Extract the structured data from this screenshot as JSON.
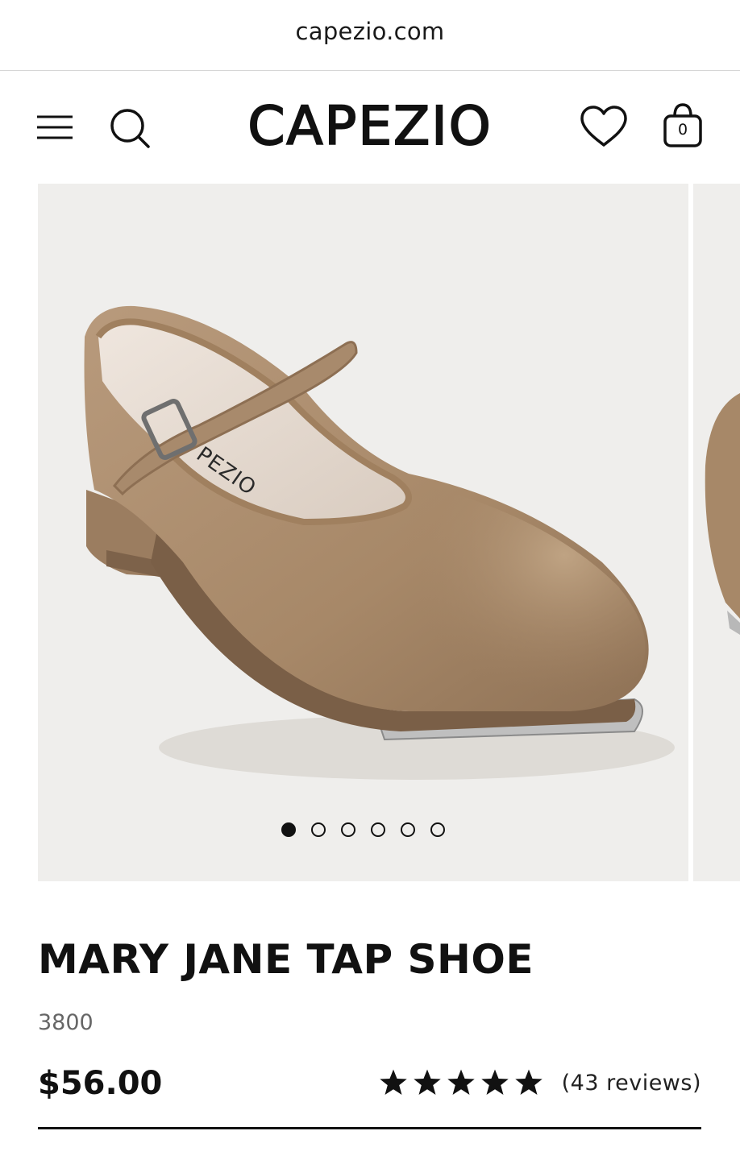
{
  "browser": {
    "url": "capezio.com"
  },
  "header": {
    "brand": "CAPEZIO",
    "cart_count": "0",
    "icons": [
      "menu-icon",
      "search-icon",
      "heart-icon",
      "bag-icon"
    ]
  },
  "gallery": {
    "image": "tan mary jane tap shoe",
    "slide_count": 6,
    "active_slide": 1
  },
  "product": {
    "name": "MARY JANE TAP SHOE",
    "sku": "3800",
    "price": "$56.00",
    "rating": 5,
    "reviews": "(43 reviews)"
  },
  "colors": {
    "shoe": "#a98a6b",
    "background": "#efeeec",
    "text": "#111111"
  }
}
